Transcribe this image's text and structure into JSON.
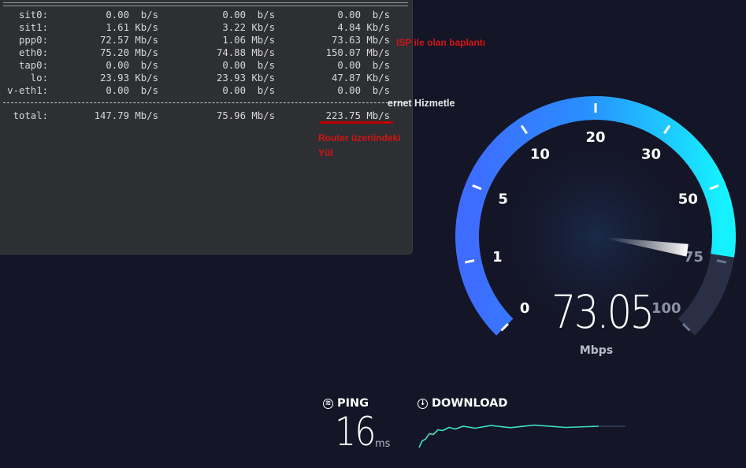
{
  "terminal": {
    "rows": [
      {
        "name": "sit0:",
        "in": "0.00  b/s",
        "out": "0.00  b/s",
        "total": "0.00  b/s"
      },
      {
        "name": "sit1:",
        "in": "1.61 Kb/s",
        "out": "3.22 Kb/s",
        "total": "4.84 Kb/s"
      },
      {
        "name": "ppp0:",
        "in": "72.57 Mb/s",
        "out": "1.06 Mb/s",
        "total": "73.63 Mb/s"
      },
      {
        "name": "eth0:",
        "in": "75.20 Mb/s",
        "out": "74.88 Mb/s",
        "total": "150.07 Mb/s"
      },
      {
        "name": "tap0:",
        "in": "0.00  b/s",
        "out": "0.00  b/s",
        "total": "0.00  b/s"
      },
      {
        "name": "lo:",
        "in": "23.93 Kb/s",
        "out": "23.93 Kb/s",
        "total": "47.87 Kb/s"
      },
      {
        "name": "v-eth1:",
        "in": "0.00  b/s",
        "out": "0.00  b/s",
        "total": "0.00  b/s"
      }
    ],
    "total_row": {
      "name": "total:",
      "in": "147.79 Mb/s",
      "out": "75.96 Mb/s",
      "total": "223.75 Mb/s"
    }
  },
  "annotations": {
    "isp": "ISP ile olan baplantı",
    "router_line1": "Router üzeriindeki",
    "router_line2": "Yül"
  },
  "background_fragment": "ernet Hizmetle",
  "speedtest": {
    "speed_value": "73.05",
    "speed_unit": "Mbps",
    "gauge_labels": [
      "0",
      "1",
      "5",
      "10",
      "20",
      "30",
      "50",
      "75",
      "100"
    ],
    "needle_speed": 73.05,
    "ping_label": "PING",
    "ping_value": "16",
    "ping_unit": "ms",
    "download_label": "DOWNLOAD",
    "colors": {
      "gauge_start": "#3f6bff",
      "gauge_end": "#15f2ff",
      "track": "#2a2f45",
      "graph": "#3fe0c8"
    }
  }
}
